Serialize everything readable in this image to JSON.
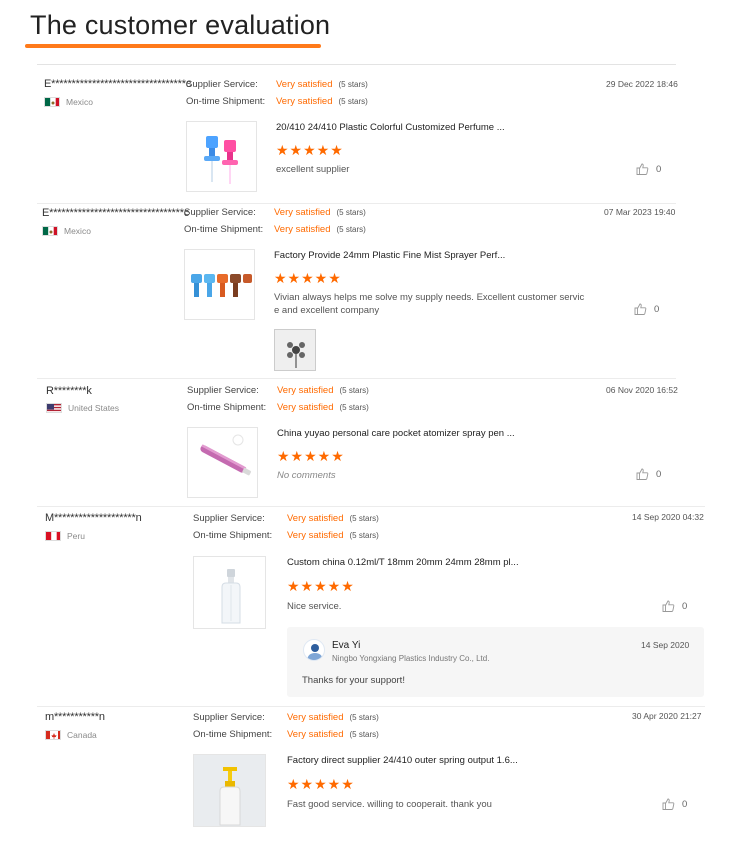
{
  "section_title": "The customer evaluation",
  "labels": {
    "supplier_service": "Supplier Service:",
    "ontime_shipment": "On-time Shipment:",
    "very_satisfied": "Very satisfied",
    "five_stars": "(5 stars)"
  },
  "star_glyphs": "★★★★★",
  "colors": {
    "accent": "#ff6a00",
    "title_underline": "#ff7a1a"
  },
  "reviews": [
    {
      "user": "E*********************************c",
      "country": "Mexico",
      "flag": "mexico-flag-icon",
      "date": "29 Dec 2022 18:46",
      "product": "20/410 24/410 Plastic Colorful Customized Perfume ...",
      "rating": 5,
      "comment": "excellent supplier",
      "likes": "0"
    },
    {
      "user": "E*********************************c",
      "country": "Mexico",
      "flag": "mexico-flag-icon",
      "date": "07 Mar 2023 19:40",
      "product": "Factory Provide 24mm Plastic Fine Mist Sprayer Perf...",
      "rating": 5,
      "comment_line1": "Vivian always helps me solve my supply needs. Excellent customer servic",
      "comment_line2": "e and excellent company",
      "likes": "0"
    },
    {
      "user": "R********k",
      "country": "United States",
      "flag": "us-flag-icon",
      "date": "06 Nov 2020 16:52",
      "product": "China yuyao personal care pocket atomizer spray pen ...",
      "rating": 5,
      "comment": "No comments",
      "likes": "0"
    },
    {
      "user": "M********************n",
      "country": "Peru",
      "flag": "peru-flag-icon",
      "date": "14 Sep 2020 04:32",
      "product": "Custom china 0.12ml/T 18mm 20mm 24mm 28mm pl...",
      "rating": 5,
      "comment": "Nice service.",
      "likes": "0",
      "reply": {
        "name": "Eva Yi",
        "company": "Ningbo Yongxiang Plastics Industry Co., Ltd.",
        "date": "14 Sep 2020",
        "text": "Thanks for your support!"
      }
    },
    {
      "user": "m***********n",
      "country": "Canada",
      "flag": "canada-flag-icon",
      "date": "30 Apr 2020 21:27",
      "product": "Factory direct supplier 24/410 outer spring output 1.6...",
      "rating": 5,
      "comment": "Fast good service.  willing to cooperait. thank you",
      "likes": "0"
    }
  ]
}
